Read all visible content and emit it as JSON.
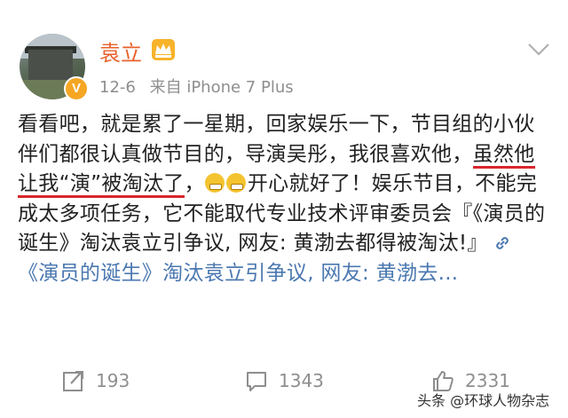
{
  "post": {
    "username": "袁立",
    "date": "12-6",
    "source": "来自 iPhone 7 Plus",
    "text_part1": "看看吧，就是累了一星期，回家娱乐一下，节目组的小伙伴们都很认真做节目的，导演吴彤，我很喜欢他，",
    "text_underlined": "虽然他让我“演”被淘汰了",
    "text_part2": "，",
    "text_part3": "开心就好了！娱乐节目，不能完成太多项任务，它不能取代专业技术评审委员会『《演员的诞生》淘汰袁立引争议, 网友: 黄渤去都得被淘汰!』",
    "link_text": "《演员的诞生》淘汰袁立引争议, 网友: 黄渤去...",
    "link_icon": "link-icon"
  },
  "actions": {
    "repost_count": "193",
    "comment_count": "1343",
    "like_count": "2331"
  },
  "watermark": {
    "prefix": "头条",
    "handle": "@环球人物杂志"
  },
  "colors": {
    "username": "#e8612c",
    "link": "#4b78b0",
    "underline": "#d9262c",
    "meta": "#8e8e8e"
  },
  "icons": [
    "avatar",
    "vip-badge-icon",
    "crown-icon",
    "chevron-down-icon",
    "repost-icon",
    "comment-icon",
    "like-icon",
    "grin-emoji-icon"
  ]
}
